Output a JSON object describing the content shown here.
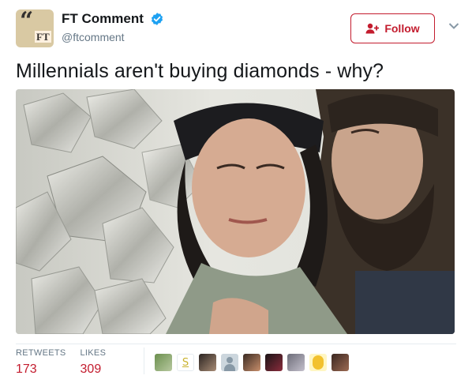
{
  "account": {
    "display_name": "FT Comment",
    "handle": "@ftcomment",
    "avatar_text": "FT",
    "verified": true
  },
  "follow_button": {
    "label": "Follow"
  },
  "tweet": {
    "text": "Millennials aren't buying diamonds - why?"
  },
  "stats": {
    "retweets_label": "RETWEETS",
    "retweets_value": "173",
    "likes_label": "LIKES",
    "likes_value": "309"
  },
  "colors": {
    "accent": "#c31c2e",
    "verified": "#1da1f2",
    "muted": "#657786"
  },
  "icons": [
    "verified-badge-icon",
    "follow-person-icon",
    "chevron-down-icon"
  ]
}
